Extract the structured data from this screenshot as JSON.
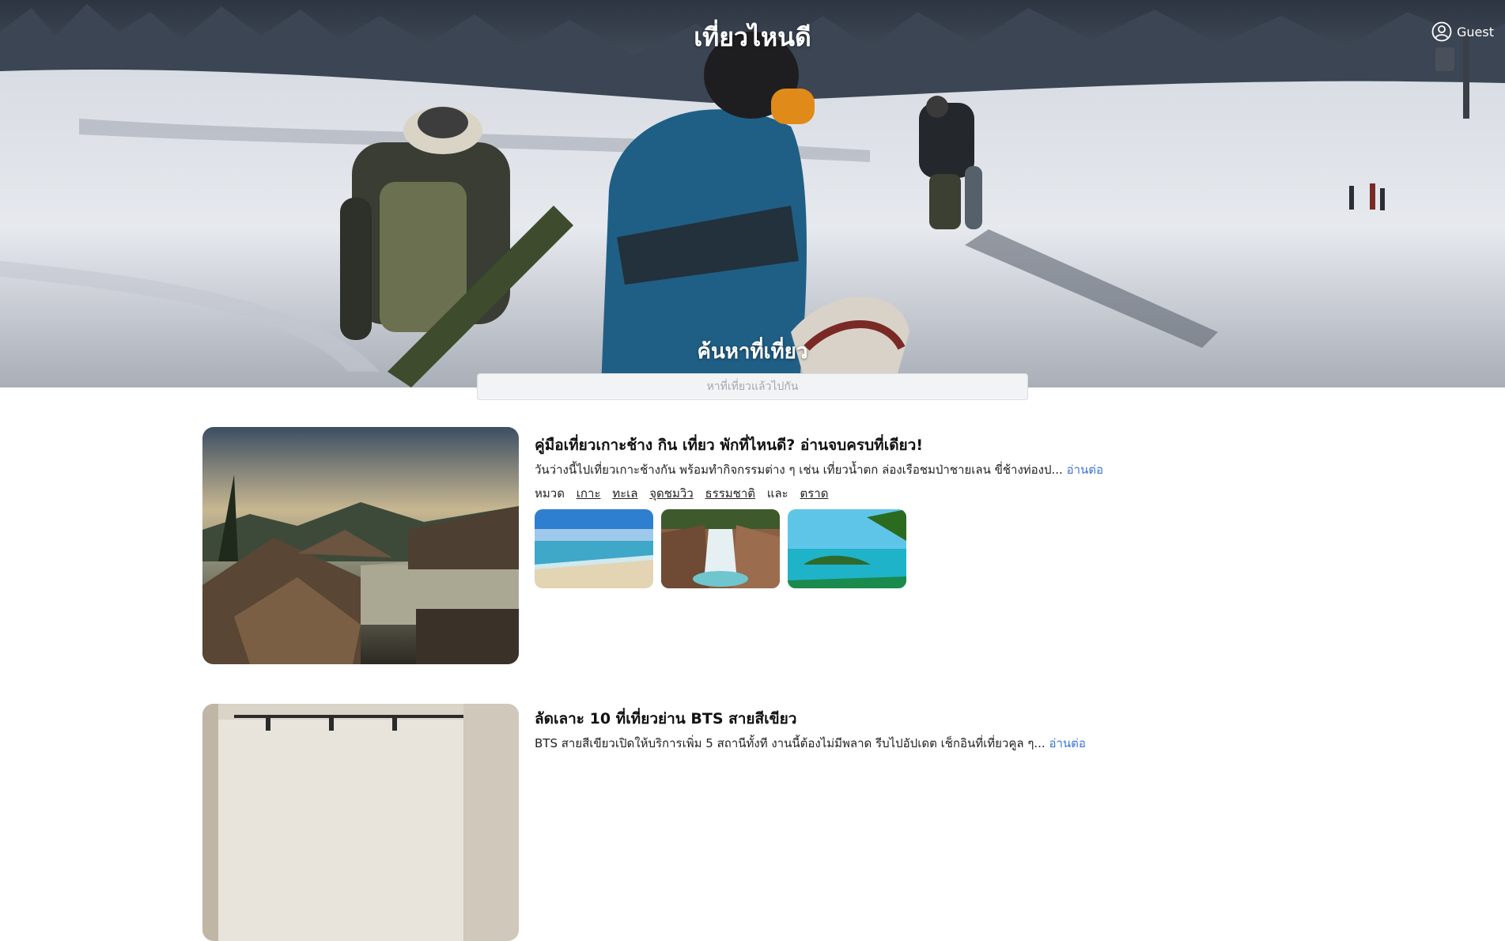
{
  "header": {
    "site_title": "เที่ยวไหนดี",
    "user_label": "Guest",
    "user_icon": "user-circle-icon"
  },
  "search": {
    "heading": "ค้นหาที่เที่ยว",
    "placeholder": "หาที่เที่ยวแล้วไปกัน"
  },
  "articles": [
    {
      "title": "คู่มือเที่ยวเกาะช้าง กิน เที่ยว พักที่ไหนดี? อ่านจบครบที่เดียว!",
      "excerpt": "วันว่างนี้ไปเที่ยวเกาะช้างกัน พร้อมทำกิจกรรมต่าง ๆ เช่น เที่ยวน้ำตก ล่องเรือชมป่าชายเลน ขี่ช้างท่องป...",
      "read_more": "อ่านต่อ",
      "category_label": "หมวด",
      "tags": [
        "เกาะ",
        "ทะเล",
        "จุดชมวิว",
        "ธรรมชาติ"
      ],
      "and_label": "และ",
      "last_tag": "ตราด"
    },
    {
      "title": "ลัดเลาะ 10 ที่เที่ยวย่าน BTS สายสีเขียว",
      "excerpt": "BTS สายสีเขียวเปิดให้บริการเพิ่ม 5 สถานีทั้งที งานนี้ต้องไม่มีพลาด รีบไปอัปเดต เช็กอินที่เที่ยวคูล ๆ...",
      "read_more": "อ่านต่อ"
    }
  ]
}
